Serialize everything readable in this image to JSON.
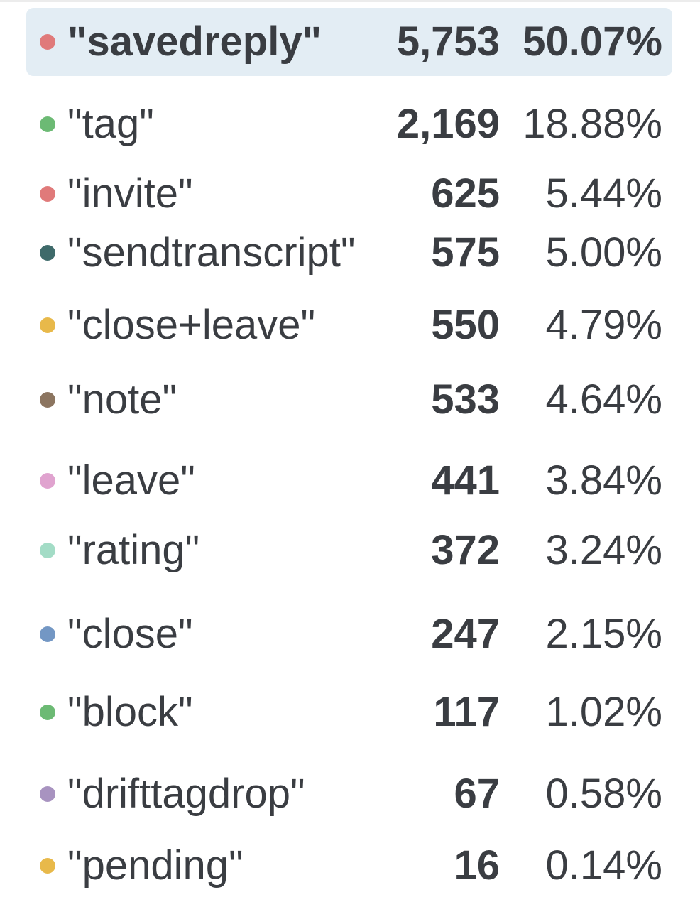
{
  "legend": {
    "items": [
      {
        "label": "\"savedreply\"",
        "count": "5,753",
        "percent": "50.07%",
        "color": "#e07a7a",
        "highlighted": true
      },
      {
        "label": "\"tag\"",
        "count": "2,169",
        "percent": "18.88%",
        "color": "#6cba74",
        "highlighted": false
      },
      {
        "label": "\"invite\"",
        "count": "625",
        "percent": "5.44%",
        "color": "#e07a7a",
        "highlighted": false
      },
      {
        "label": "\"sendtranscript\"",
        "count": "575",
        "percent": "5.00%",
        "color": "#3e6a6a",
        "highlighted": false
      },
      {
        "label": "\"close+leave\"",
        "count": "550",
        "percent": "4.79%",
        "color": "#e8b94a",
        "highlighted": false
      },
      {
        "label": "\"note\"",
        "count": "533",
        "percent": "4.64%",
        "color": "#8c7560",
        "highlighted": false
      },
      {
        "label": "\"leave\"",
        "count": "441",
        "percent": "3.84%",
        "color": "#e0a3cf",
        "highlighted": false
      },
      {
        "label": "\"rating\"",
        "count": "372",
        "percent": "3.24%",
        "color": "#a3dcc6",
        "highlighted": false
      },
      {
        "label": "\"close\"",
        "count": "247",
        "percent": "2.15%",
        "color": "#7397c4",
        "highlighted": false
      },
      {
        "label": "\"block\"",
        "count": "117",
        "percent": "1.02%",
        "color": "#6cba74",
        "highlighted": false
      },
      {
        "label": "\"drifttagdrop\"",
        "count": "67",
        "percent": "0.58%",
        "color": "#a893c0",
        "highlighted": false
      },
      {
        "label": "\"pending\"",
        "count": "16",
        "percent": "0.14%",
        "color": "#e8b94a",
        "highlighted": false
      }
    ]
  }
}
